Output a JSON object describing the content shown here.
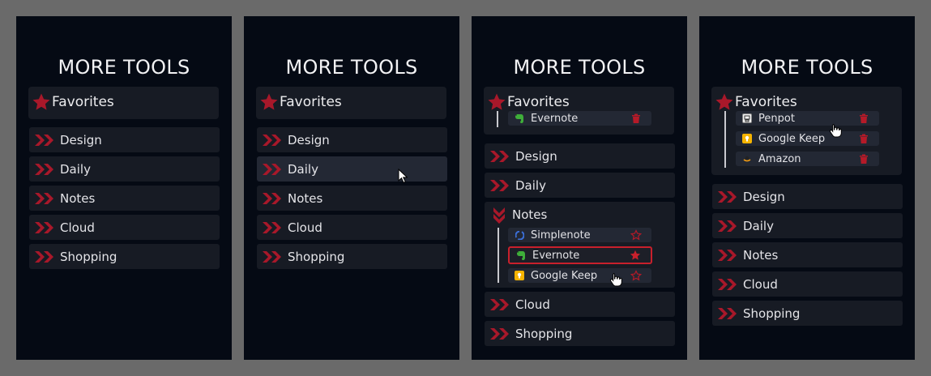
{
  "panels": [
    {
      "title": "MORE TOOLS",
      "favorites_label": "Favorites",
      "categories": [
        "Design",
        "Daily",
        "Notes",
        "Cloud",
        "Shopping"
      ]
    },
    {
      "title": "MORE TOOLS",
      "favorites_label": "Favorites",
      "categories": [
        "Design",
        "Daily",
        "Notes",
        "Cloud",
        "Shopping"
      ]
    },
    {
      "title": "MORE TOOLS",
      "favorites_label": "Favorites",
      "favorites_items": [
        "Evernote"
      ],
      "categories": [
        "Design",
        "Daily",
        "Notes",
        "Cloud",
        "Shopping"
      ],
      "notes_items": [
        "Simplenote",
        "Evernote",
        "Google Keep"
      ]
    },
    {
      "title": "MORE TOOLS",
      "favorites_label": "Favorites",
      "favorites_items": [
        "Penpot",
        "Google Keep",
        "Amazon"
      ],
      "categories": [
        "Design",
        "Daily",
        "Notes",
        "Cloud",
        "Shopping"
      ]
    }
  ],
  "colors": {
    "accent": "#c8202c",
    "panel_bg": "#050a14",
    "item_bg": "#171b24",
    "outer_bg": "#6a6a6a"
  },
  "icons": {
    "favorites": "star-icon",
    "category": "double-chevron-right-icon",
    "expanded_category": "double-chevron-down-icon",
    "remove": "trash-icon",
    "add_favorite": "star-outline-icon",
    "is_favorite": "star-filled-icon"
  }
}
